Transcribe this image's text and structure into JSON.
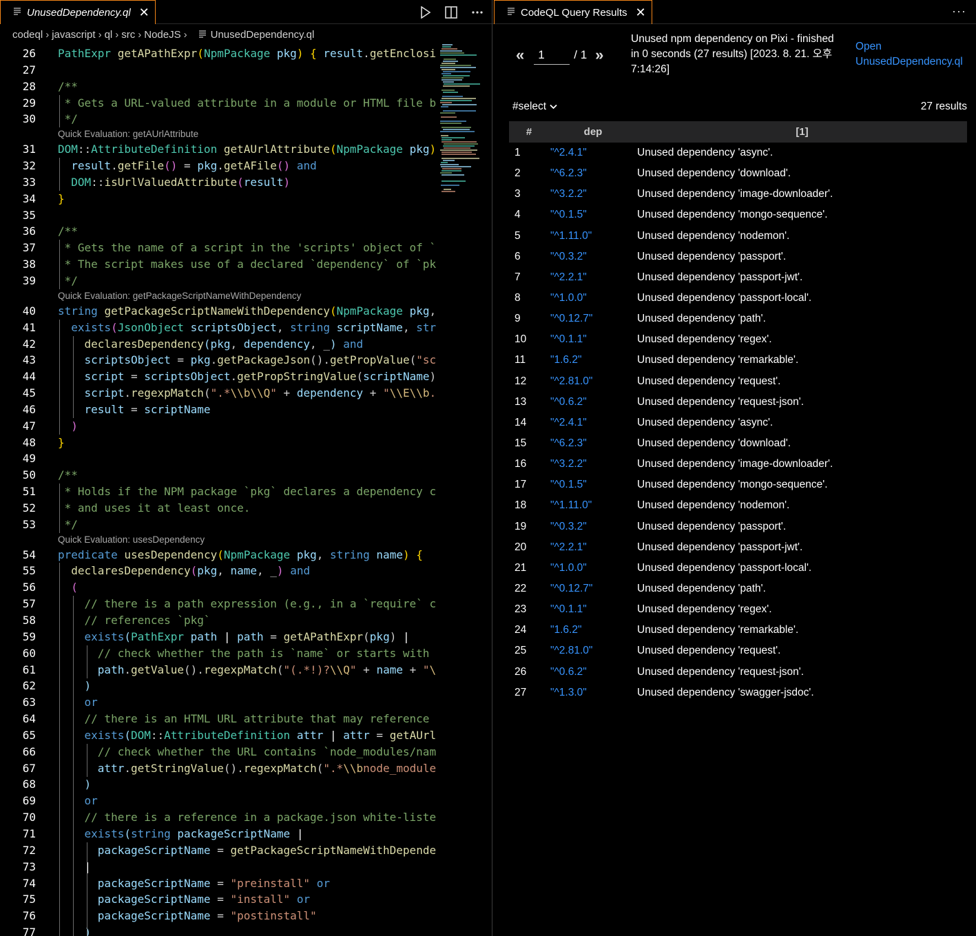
{
  "editor": {
    "tab_title": "UnusedDependency.ql",
    "tab_close": "✕",
    "breadcrumb": [
      "codeql",
      "javascript",
      "ql",
      "src",
      "NodeJS",
      "UnusedDependency.ql"
    ],
    "actions": [
      "run-icon",
      "split-editor-icon",
      "more-icon"
    ],
    "lens_labels": {
      "l31": "Quick Evaluation: getAUrlAttribute",
      "l40": "Quick Evaluation: getPackageScriptNameWithDependency",
      "l54": "Quick Evaluation: usesDependency"
    }
  },
  "results": {
    "tab_title": "CodeQL Query Results",
    "tab_close": "✕",
    "more": "···",
    "pager": {
      "prev": "«",
      "current_page": "1",
      "total": "/ 1",
      "next": "»"
    },
    "query_meta": "Unused npm dependency on Pixi - finished in 0 seconds (27 results) [2023. 8. 21. 오후 7:14:26]",
    "open_link_label": "Open",
    "open_link_file": "UnusedDependency.ql",
    "select_label": "#select",
    "result_count": "27 results",
    "columns": [
      "#",
      "dep",
      "[1]"
    ],
    "rows": [
      [
        "1",
        "\"^2.4.1\"",
        "Unused dependency 'async'."
      ],
      [
        "2",
        "\"^6.2.3\"",
        "Unused dependency 'download'."
      ],
      [
        "3",
        "\"^3.2.2\"",
        "Unused dependency 'image-downloader'."
      ],
      [
        "4",
        "\"^0.1.5\"",
        "Unused dependency 'mongo-sequence'."
      ],
      [
        "5",
        "\"^1.11.0\"",
        "Unused dependency 'nodemon'."
      ],
      [
        "6",
        "\"^0.3.2\"",
        "Unused dependency 'passport'."
      ],
      [
        "7",
        "\"^2.2.1\"",
        "Unused dependency 'passport-jwt'."
      ],
      [
        "8",
        "\"^1.0.0\"",
        "Unused dependency 'passport-local'."
      ],
      [
        "9",
        "\"^0.12.7\"",
        "Unused dependency 'path'."
      ],
      [
        "10",
        "\"^0.1.1\"",
        "Unused dependency 'regex'."
      ],
      [
        "11",
        "\"1.6.2\"",
        "Unused dependency 'remarkable'."
      ],
      [
        "12",
        "\"^2.81.0\"",
        "Unused dependency 'request'."
      ],
      [
        "13",
        "\"^0.6.2\"",
        "Unused dependency 'request-json'."
      ],
      [
        "14",
        "\"^2.4.1\"",
        "Unused dependency 'async'."
      ],
      [
        "15",
        "\"^6.2.3\"",
        "Unused dependency 'download'."
      ],
      [
        "16",
        "\"^3.2.2\"",
        "Unused dependency 'image-downloader'."
      ],
      [
        "17",
        "\"^0.1.5\"",
        "Unused dependency 'mongo-sequence'."
      ],
      [
        "18",
        "\"^1.11.0\"",
        "Unused dependency 'nodemon'."
      ],
      [
        "19",
        "\"^0.3.2\"",
        "Unused dependency 'passport'."
      ],
      [
        "20",
        "\"^2.2.1\"",
        "Unused dependency 'passport-jwt'."
      ],
      [
        "21",
        "\"^1.0.0\"",
        "Unused dependency 'passport-local'."
      ],
      [
        "22",
        "\"^0.12.7\"",
        "Unused dependency 'path'."
      ],
      [
        "23",
        "\"^0.1.1\"",
        "Unused dependency 'regex'."
      ],
      [
        "24",
        "\"1.6.2\"",
        "Unused dependency 'remarkable'."
      ],
      [
        "25",
        "\"^2.81.0\"",
        "Unused dependency 'request'."
      ],
      [
        "26",
        "\"^0.6.2\"",
        "Unused dependency 'request-json'."
      ],
      [
        "27",
        "\"^1.3.0\"",
        "Unused dependency 'swagger-jsdoc'."
      ]
    ]
  },
  "colors": {
    "keyword": "#569cd6",
    "type": "#4ec9b0",
    "function": "#dcdcaa",
    "variable": "#9cdcfe",
    "comment": "#7ca668",
    "string": "#ce9178",
    "link": "#3794ff",
    "focus_border": "#f38518"
  }
}
